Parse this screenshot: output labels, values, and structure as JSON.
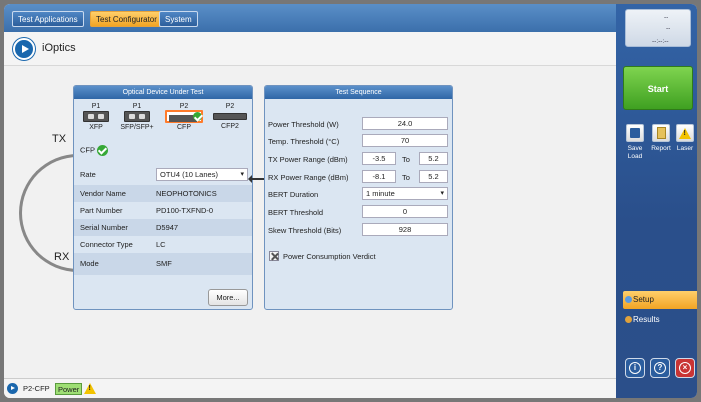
{
  "tabs": [
    "Test Applications",
    "Test Configurator",
    "System"
  ],
  "app": {
    "title": "iOptics"
  },
  "labels": {
    "tx": "TX",
    "rx": "RX"
  },
  "oduPanel": {
    "title": "Optical Device Under Test",
    "ports": [
      {
        "top": "P1",
        "bottom": "XFP"
      },
      {
        "top": "P1",
        "bottom": "SFP/SFP+"
      },
      {
        "top": "P2",
        "bottom": "CFP"
      },
      {
        "top": "P2",
        "bottom": "CFP2"
      }
    ],
    "selected": "CFP",
    "rateLabel": "Rate",
    "rateValue": "OTU4 (10 Lanes)",
    "info": [
      {
        "key": "Vendor Name",
        "value": "NEOPHOTONICS"
      },
      {
        "key": "Part Number",
        "value": "PD100-TXFND-0"
      },
      {
        "key": "Serial Number",
        "value": "D5947"
      },
      {
        "key": "Connector Type",
        "value": "LC"
      },
      {
        "key": "Mode",
        "value": "SMF"
      }
    ],
    "moreButton": "More..."
  },
  "testSeq": {
    "title": "Test Sequence",
    "powerThreshold": {
      "label": "Power Threshold (W)",
      "value": "24.0"
    },
    "tempThreshold": {
      "label": "Temp. Threshold (°C)",
      "value": "70"
    },
    "txRange": {
      "label": "TX Power Range (dBm)",
      "min": "-3.5",
      "to": "To",
      "max": "5.2"
    },
    "rxRange": {
      "label": "RX Power Range (dBm)",
      "min": "-8.1",
      "to": "To",
      "max": "5.2"
    },
    "bertDuration": {
      "label": "BERT Duration",
      "value": "1 minute"
    },
    "bertThreshold": {
      "label": "BERT Threshold",
      "value": "0"
    },
    "skewThreshold": {
      "label": "Skew Threshold (Bits)",
      "value": "928"
    },
    "verdict": "Power Consumption Verdict"
  },
  "status": {
    "port": "P2-CFP",
    "power": "Power"
  },
  "sidebar": {
    "clock": [
      "--",
      "--",
      "--:--:--"
    ],
    "start": "Start",
    "tools": [
      {
        "label": "Save Load",
        "icon": "save-load-icon"
      },
      {
        "label": "Report",
        "icon": "report-icon"
      },
      {
        "label": "Laser",
        "icon": "laser-icon"
      }
    ],
    "nav": [
      {
        "label": "Setup",
        "active": true
      },
      {
        "label": "Results",
        "active": false
      }
    ]
  }
}
